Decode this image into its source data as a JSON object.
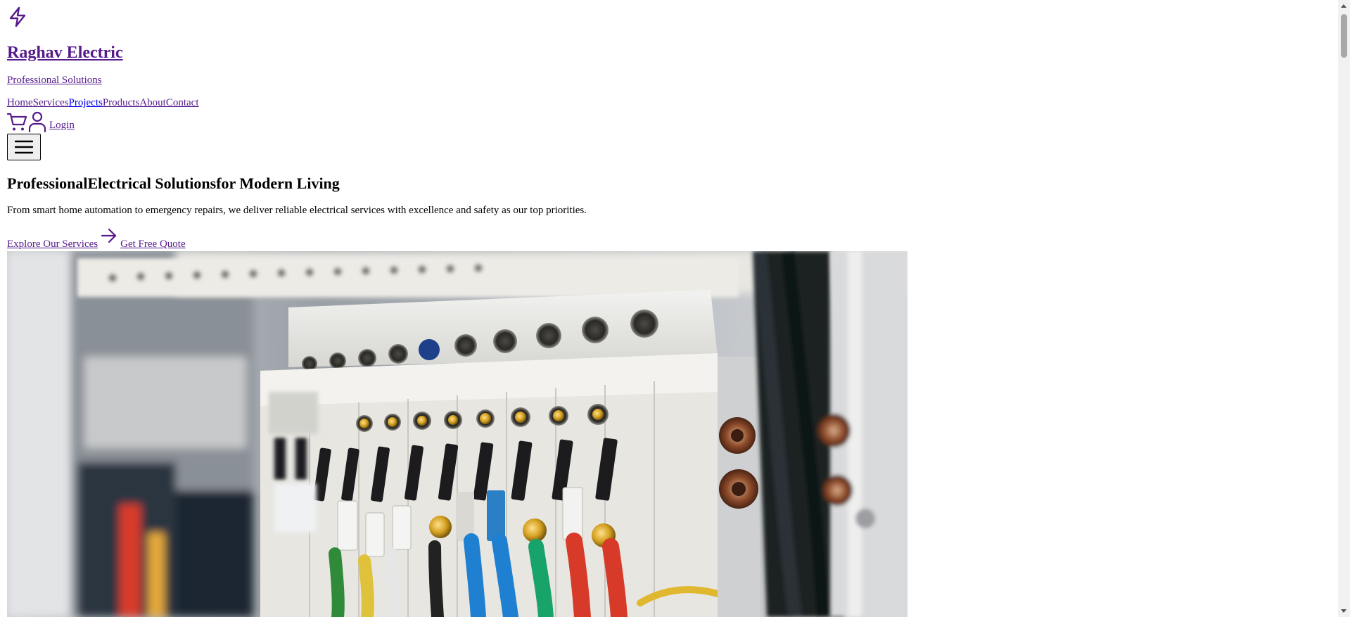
{
  "header": {
    "logo_icon": "lightning-bolt-icon",
    "brand_name": "Raghav Electric",
    "tagline": "Professional Solutions"
  },
  "nav": {
    "items": [
      {
        "label": "Home"
      },
      {
        "label": "Services"
      },
      {
        "label": "Projects"
      },
      {
        "label": "Products"
      },
      {
        "label": "About"
      },
      {
        "label": "Contact"
      }
    ]
  },
  "actions": {
    "cart_icon": "shopping-cart-icon",
    "user_icon": "user-icon",
    "login_label": "Login",
    "menu_icon": "hamburger-menu-icon"
  },
  "hero": {
    "title_part1": "Professional",
    "title_part2": "Electrical Solutions",
    "title_part3": "for Modern Living",
    "description": "From smart home automation to emergency repairs, we deliver reliable electrical services with excellence and safety as our top priorities.",
    "primary_cta": "Explore Our Services",
    "arrow_icon": "arrow-right-icon",
    "secondary_cta": "Get Free Quote",
    "image_subject": "electrical-panel-photo"
  },
  "colors": {
    "link_visited": "#551a8b",
    "link_unvisited": "#0000ee",
    "text": "#000000",
    "background": "#ffffff"
  }
}
